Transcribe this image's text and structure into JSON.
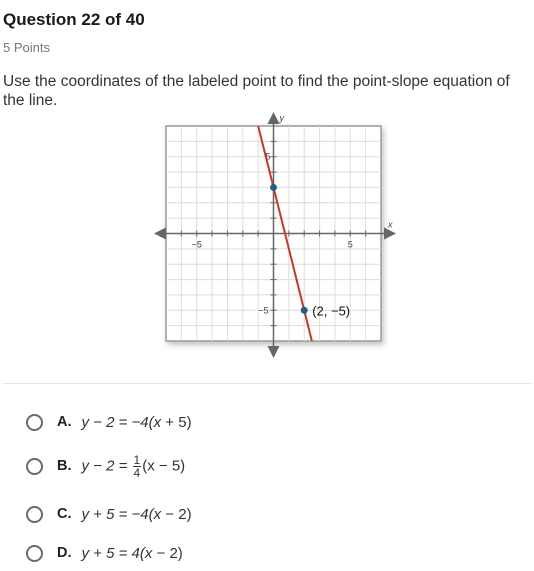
{
  "header": {
    "title": "Question 22 of 40",
    "points": "5 Points"
  },
  "question": {
    "prompt": "Use the coordinates of the labeled point to find the point-slope equation of the line."
  },
  "graph": {
    "x_axis_label": "x",
    "y_axis_label": "y",
    "x_tick_labels": [
      "−5",
      "5"
    ],
    "y_tick_labels": [
      "5",
      "−5"
    ],
    "range": {
      "xmin": -7,
      "xmax": 7,
      "ymin": -7,
      "ymax": 7
    },
    "line": {
      "slope": -4,
      "intercept": 3,
      "color": "#c0392b"
    },
    "points": [
      {
        "x": 0,
        "y": 3,
        "label": ""
      },
      {
        "x": 2,
        "y": -5,
        "label": "(2, −5)"
      }
    ],
    "point_color": "#1f5f8b"
  },
  "options": [
    {
      "letter": "A.",
      "lhs": "y − 2 = −4(",
      "var": "x",
      "rhs": " + 5)"
    },
    {
      "letter": "B.",
      "lhs": "y − 2 = ",
      "frac_num": "1",
      "frac_den": "4",
      "after": "(x − 5)"
    },
    {
      "letter": "C.",
      "lhs": "y + 5 = −4(",
      "var": "x",
      "rhs": " − 2)"
    },
    {
      "letter": "D.",
      "lhs": "y + 5 = 4(",
      "var": "x",
      "rhs": " − 2)"
    }
  ]
}
